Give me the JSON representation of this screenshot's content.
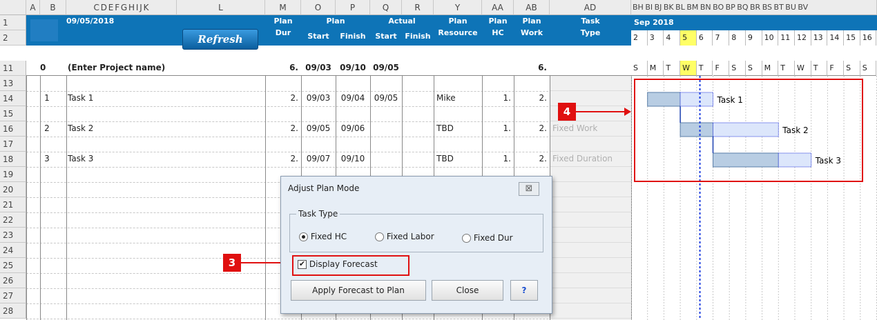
{
  "colors": {
    "accent": "#0e74b7",
    "annotation": "#e01010",
    "bar_plan": "#b8cde3",
    "bar_forecast": "#ffffff",
    "today_line": "#1f3fe0"
  },
  "columns": {
    "a": "A",
    "b": "B",
    "cdefghijk": "C D E F G H I J K",
    "l": "L",
    "m": "M",
    "o": "O",
    "p": "P",
    "q": "Q",
    "r": "R",
    "y": "Y",
    "aa": "AA",
    "ab": "AB",
    "ad": "AD",
    "gantt": "BH BI BJ BK BL BM BN BO BP BQ BR BS BT BU BV"
  },
  "rows": [
    "1",
    "2",
    "11",
    "13",
    "14",
    "15",
    "16",
    "17",
    "18",
    "19",
    "20",
    "21",
    "22",
    "23",
    "24",
    "25",
    "26",
    "27",
    "28"
  ],
  "header": {
    "date": "09/05/2018",
    "refresh": "Refresh",
    "plan_dur_1": "Plan",
    "plan_dur_2": "Dur",
    "plan": "Plan",
    "start": "Start",
    "finish": "Finish",
    "actual": "Actual",
    "actual_start": "Start",
    "actual_finish": "Finish",
    "plan_resource_1": "Plan",
    "plan_resource_2": "Resource",
    "plan_hc_1": "Plan",
    "plan_hc_2": "HC",
    "plan_work_1": "Plan",
    "plan_work_2": "Work",
    "task_type_1": "Task",
    "task_type_2": "Type",
    "month": "Sep 2018",
    "days": [
      "2",
      "3",
      "4",
      "5",
      "6",
      "7",
      "8",
      "9",
      "10",
      "11",
      "12",
      "13",
      "14",
      "15",
      "16"
    ],
    "weekdays": [
      "S",
      "M",
      "T",
      "W",
      "T",
      "F",
      "S",
      "S",
      "M",
      "T",
      "W",
      "T",
      "F",
      "S",
      "S"
    ]
  },
  "project": {
    "id": "0",
    "name": "(Enter Project name)",
    "dur": "6.",
    "start": "09/03",
    "finish": "09/10",
    "actual_start": "09/05",
    "work": "6."
  },
  "tasks": [
    {
      "id": "1",
      "name": "Task 1",
      "dur": "2.",
      "start": "09/03",
      "finish": "09/04",
      "actual_start": "09/05",
      "resource": "Mike",
      "hc": "1.",
      "work": "2.",
      "type": ""
    },
    {
      "id": "2",
      "name": "Task 2",
      "dur": "2.",
      "start": "09/05",
      "finish": "09/06",
      "actual_start": "",
      "resource": "TBD",
      "hc": "1.",
      "work": "2.",
      "type": "Fixed Work"
    },
    {
      "id": "3",
      "name": "Task 3",
      "dur": "2.",
      "start": "09/07",
      "finish": "09/10",
      "actual_start": "",
      "resource": "TBD",
      "hc": "1.",
      "work": "2.",
      "type": "Fixed Duration"
    }
  ],
  "gantt_labels": [
    "Task 1",
    "Task 2",
    "Task 3"
  ],
  "dialog": {
    "title": "Adjust Plan Mode",
    "close_x": "⊠",
    "group": "Task Type",
    "radio_fixed_hc": "Fixed HC",
    "radio_fixed_labor": "Fixed Labor",
    "radio_fixed_dur": "Fixed Dur",
    "checkbox": "Display Forecast",
    "apply": "Apply Forecast to Plan",
    "close": "Close",
    "help": "?"
  },
  "callouts": {
    "three": "3",
    "four": "4"
  }
}
